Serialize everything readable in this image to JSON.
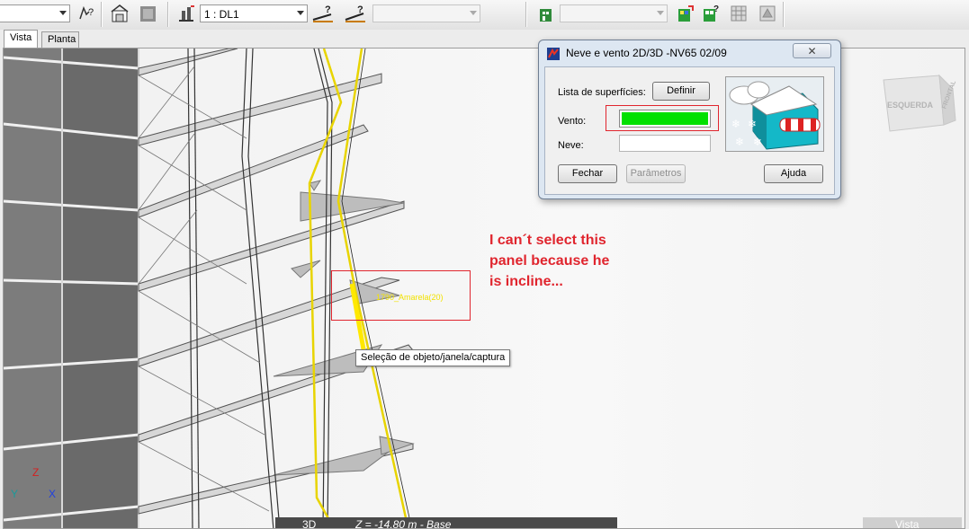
{
  "toolbar": {
    "first_combo_value": "",
    "layer_combo_value": "1 : DL1",
    "disabled_combo_value": "",
    "right_combo_value": "",
    "icons": [
      "help-pointer-icon",
      "house-icon",
      "gray-block-icon",
      "load-case-icon",
      "ramp-help-icon",
      "ramp-icon",
      "green-building-icon",
      "colored-building-icon",
      "wind-building-icon",
      "grid-icon-a",
      "grid-icon-b"
    ]
  },
  "tabs": [
    {
      "label": "Vista",
      "active": true
    },
    {
      "label": "Planta",
      "active": false
    }
  ],
  "viewport": {
    "view_cube_labels": [
      "ESQUERDA",
      "FRONTAL"
    ],
    "object_label": "1790_Amarela(20)",
    "axes": {
      "z": "Z",
      "y": "Y",
      "x": "X"
    },
    "tooltip": "Seleção de objeto/janela/captura",
    "status": {
      "mode": "3D",
      "level": "Z = -14.80 m - Base",
      "view": "Vista"
    }
  },
  "annotation": {
    "lines": [
      "I can´t select this",
      "panel because he",
      "is incline..."
    ],
    "color": "#e0252e"
  },
  "dialog": {
    "title": "Neve e vento 2D/3D -NV65 02/09",
    "close_label": "✕",
    "surfaces_label": "Lista de superfícies:",
    "define_button": "Definir",
    "wind_label": "Vento:",
    "wind_value": "",
    "wind_color": "#00e000",
    "snow_label": "Neve:",
    "snow_value": "",
    "close_button": "Fechar",
    "params_button": "Parâmetros",
    "help_button": "Ajuda"
  }
}
